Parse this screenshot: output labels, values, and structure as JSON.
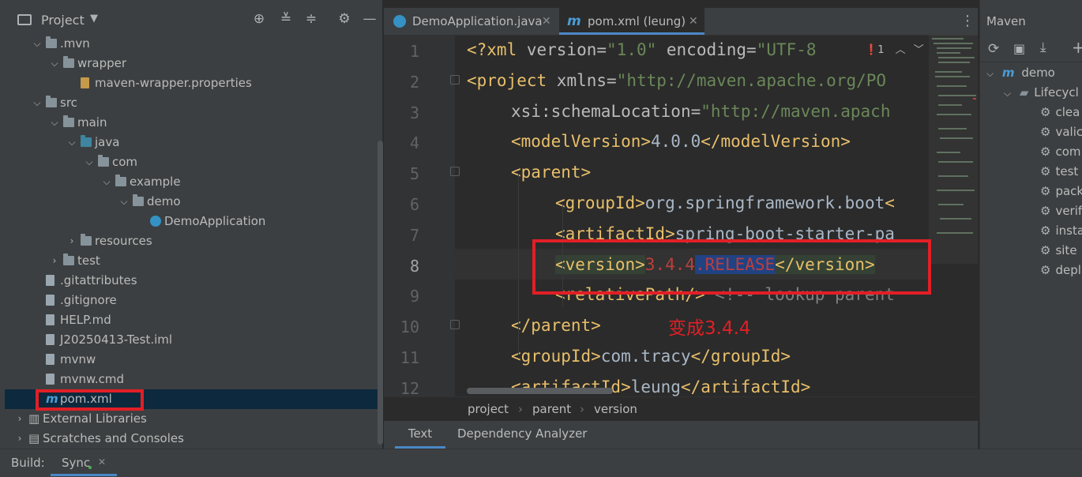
{
  "project": {
    "title": "Project",
    "tree": [
      {
        "label": ".mvn",
        "type": "folder",
        "depth": 1,
        "expanded": true
      },
      {
        "label": "wrapper",
        "type": "folder",
        "depth": 2,
        "expanded": true
      },
      {
        "label": "maven-wrapper.properties",
        "type": "properties-file",
        "depth": 3
      },
      {
        "label": "src",
        "type": "folder",
        "depth": 1,
        "expanded": true
      },
      {
        "label": "main",
        "type": "folder",
        "depth": 2,
        "expanded": true
      },
      {
        "label": "java",
        "type": "source-folder",
        "depth": 3,
        "expanded": true
      },
      {
        "label": "com",
        "type": "package",
        "depth": 4,
        "expanded": true
      },
      {
        "label": "example",
        "type": "package",
        "depth": 5,
        "expanded": true
      },
      {
        "label": "demo",
        "type": "package",
        "depth": 6,
        "expanded": true
      },
      {
        "label": "DemoApplication",
        "type": "java-class",
        "depth": 7
      },
      {
        "label": "resources",
        "type": "folder",
        "depth": 3,
        "expanded": false
      },
      {
        "label": "test",
        "type": "folder",
        "depth": 2,
        "expanded": false
      },
      {
        "label": ".gitattributes",
        "type": "file",
        "depth": 1
      },
      {
        "label": ".gitignore",
        "type": "file",
        "depth": 1
      },
      {
        "label": "HELP.md",
        "type": "md-file",
        "depth": 1
      },
      {
        "label": "J20250413-Test.iml",
        "type": "file",
        "depth": 1
      },
      {
        "label": "mvnw",
        "type": "script-file",
        "depth": 1
      },
      {
        "label": "mvnw.cmd",
        "type": "file",
        "depth": 1
      },
      {
        "label": "pom.xml",
        "type": "maven-file",
        "depth": 1,
        "selected": true
      },
      {
        "label": "External Libraries",
        "type": "libraries",
        "depth": 0,
        "expanded": false
      },
      {
        "label": "Scratches and Consoles",
        "type": "scratches",
        "depth": 0,
        "expanded": false
      }
    ]
  },
  "editor": {
    "tabs": [
      {
        "label": "DemoApplication.java",
        "active": false
      },
      {
        "label": "pom.xml (leung)",
        "active": true
      }
    ],
    "problem_count": "1",
    "lines": [
      {
        "n": "1"
      },
      {
        "n": "2"
      },
      {
        "n": "3"
      },
      {
        "n": "4"
      },
      {
        "n": "5"
      },
      {
        "n": "6"
      },
      {
        "n": "7"
      },
      {
        "n": "8"
      },
      {
        "n": "9"
      },
      {
        "n": "10"
      },
      {
        "n": "11"
      },
      {
        "n": "12"
      }
    ],
    "code": {
      "l1_a": "<?xml ",
      "l1_b": "version",
      "l1_c": "=",
      "l1_d": "\"1.0\"",
      "l1_e": " encoding",
      "l1_f": "=",
      "l1_g": "\"UTF-8",
      "l2_a": "<project ",
      "l2_b": "xmlns",
      "l2_c": "=",
      "l2_d": "\"http://maven.apache.org/PO",
      "l3_a": "xsi",
      "l3_b": ":schemaLocation",
      "l3_c": "=",
      "l3_d": "\"http://maven.apach",
      "l4_a": "<modelVersion>",
      "l4_b": "4.0.0",
      "l4_c": "</modelVersion>",
      "l5_a": "<parent>",
      "l6_a": "<groupId>",
      "l6_b": "org.springframework.boot",
      "l6_c": "<",
      "l7_a": "<artifactId>",
      "l7_b": "spring-boot-starter-pa",
      "l8_a": "<version>",
      "l8_b": "3.4.4",
      "l8_c": ".RELEASE",
      "l8_d": "</version>",
      "l9_a": "<relativePath/>",
      "l9_b": " <!-- lookup parent",
      "l10_a": "</parent>",
      "l11_a": "<groupId>",
      "l11_b": "com.tracy",
      "l11_c": "</groupId>",
      "l12_a": "<artifactId>",
      "l12_b": "leung",
      "l12_c": "</artifactId>"
    },
    "annotation": "变成3.4.4",
    "breadcrumb": [
      "project",
      "parent",
      "version"
    ],
    "bottom_tabs": [
      "Text",
      "Dependency Analyzer"
    ]
  },
  "maven": {
    "title": "Maven",
    "project": "demo",
    "lifecycle_label": "Lifecycl",
    "phases": [
      "clea",
      "valic",
      "com",
      "test",
      "pack",
      "verif",
      "insta",
      "site",
      "depl"
    ]
  },
  "statusbar": {
    "build_label": "Build:",
    "sync_tab": "Sync"
  },
  "colors": {
    "accent": "#4a88c7",
    "selection": "#0d293e",
    "highlight_box": "#e11f26",
    "annotation": "#e11f26"
  }
}
